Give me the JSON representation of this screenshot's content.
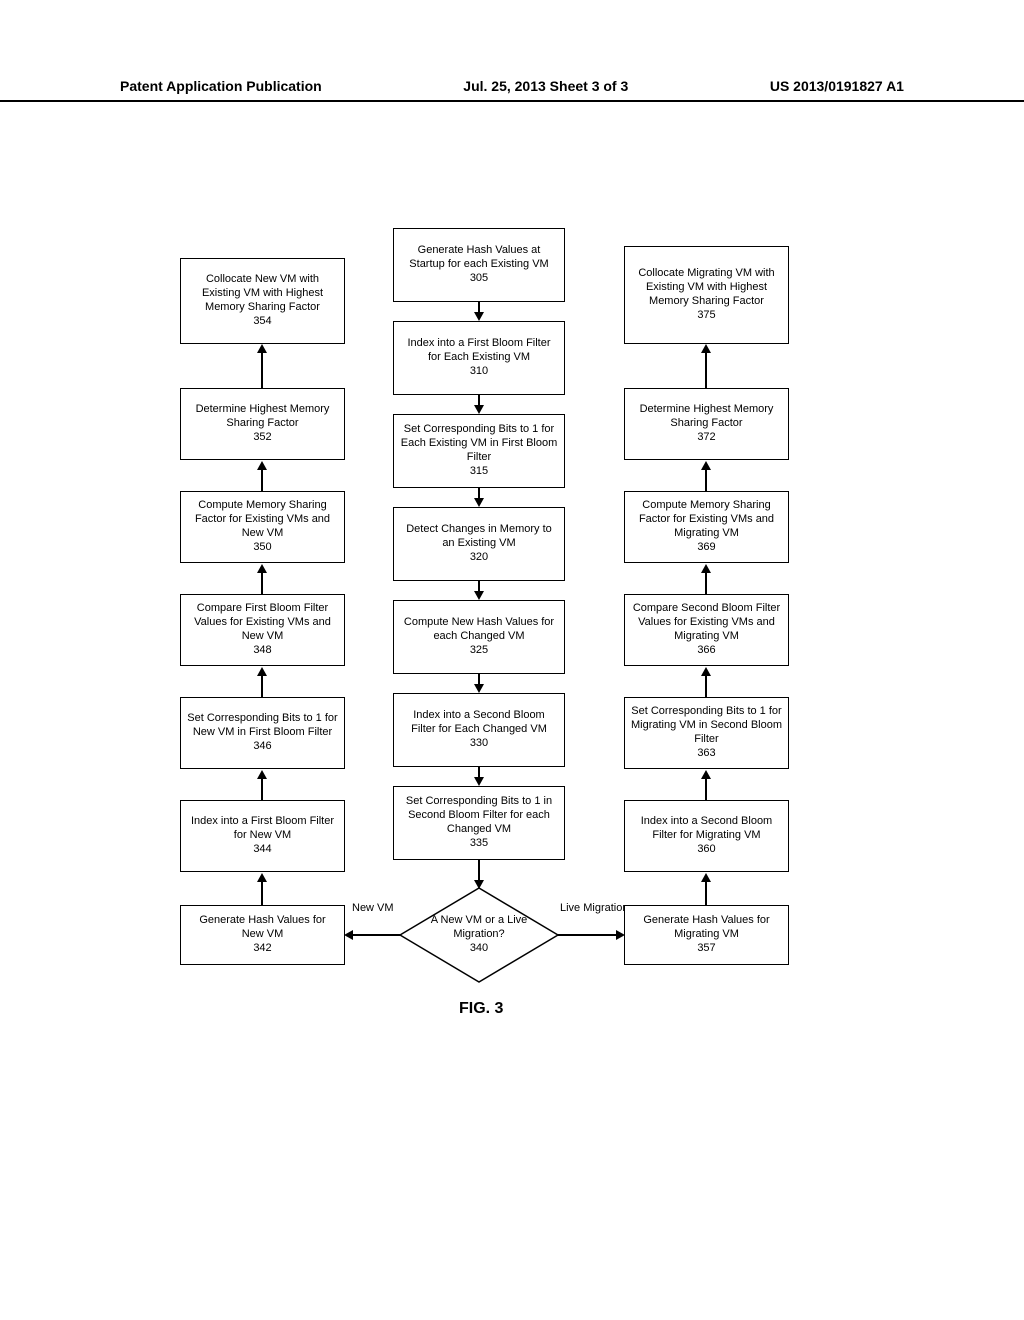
{
  "header": {
    "left": "Patent Application Publication",
    "center": "Jul. 25, 2013  Sheet 3 of 3",
    "right": "US 2013/0191827 A1"
  },
  "figure_caption": "FIG. 3",
  "center_column": [
    {
      "text": "Generate Hash Values at Startup for each Existing VM",
      "num": "305"
    },
    {
      "text": "Index into a First Bloom Filter for Each Existing VM",
      "num": "310"
    },
    {
      "text": "Set Corresponding Bits to 1 for Each Existing VM in First Bloom Filter",
      "num": "315"
    },
    {
      "text": "Detect Changes in Memory to an Existing VM",
      "num": "320"
    },
    {
      "text": "Compute New Hash Values for each Changed VM",
      "num": "325"
    },
    {
      "text": "Index into a Second Bloom Filter for Each Changed VM",
      "num": "330"
    },
    {
      "text": "Set Corresponding Bits to 1 in Second Bloom Filter for each Changed VM",
      "num": "335"
    }
  ],
  "decision": {
    "text": "A New VM or a Live Migration?",
    "num": "340",
    "left_label": "New VM",
    "right_label": "Live Migration"
  },
  "left_column": [
    {
      "text": "Generate Hash Values for New VM",
      "num": "342"
    },
    {
      "text": "Index into a First Bloom Filter for New VM",
      "num": "344"
    },
    {
      "text": "Set Corresponding Bits to 1 for New VM in First Bloom Filter",
      "num": "346"
    },
    {
      "text": "Compare First Bloom Filter Values for Existing VMs and New VM",
      "num": "348"
    },
    {
      "text": "Compute Memory Sharing Factor for Existing VMs and New VM",
      "num": "350"
    },
    {
      "text": "Determine Highest Memory Sharing Factor",
      "num": "352"
    },
    {
      "text": "Collocate New VM with Existing VM with Highest Memory Sharing Factor",
      "num": "354"
    }
  ],
  "right_column": [
    {
      "text": "Generate Hash Values for Migrating VM",
      "num": "357"
    },
    {
      "text": "Index into a Second Bloom Filter for Migrating VM",
      "num": "360"
    },
    {
      "text": "Set Corresponding Bits to 1 for Migrating VM in Second Bloom Filter",
      "num": "363"
    },
    {
      "text": "Compare Second Bloom Filter Values for Existing VMs and Migrating VM",
      "num": "366"
    },
    {
      "text": "Compute Memory Sharing Factor for Existing VMs and Migrating VM",
      "num": "369"
    },
    {
      "text": "Determine Highest Memory Sharing Factor",
      "num": "372"
    },
    {
      "text": "Collocate Migrating VM with Existing VM with Highest Memory Sharing Factor",
      "num": "375"
    }
  ]
}
